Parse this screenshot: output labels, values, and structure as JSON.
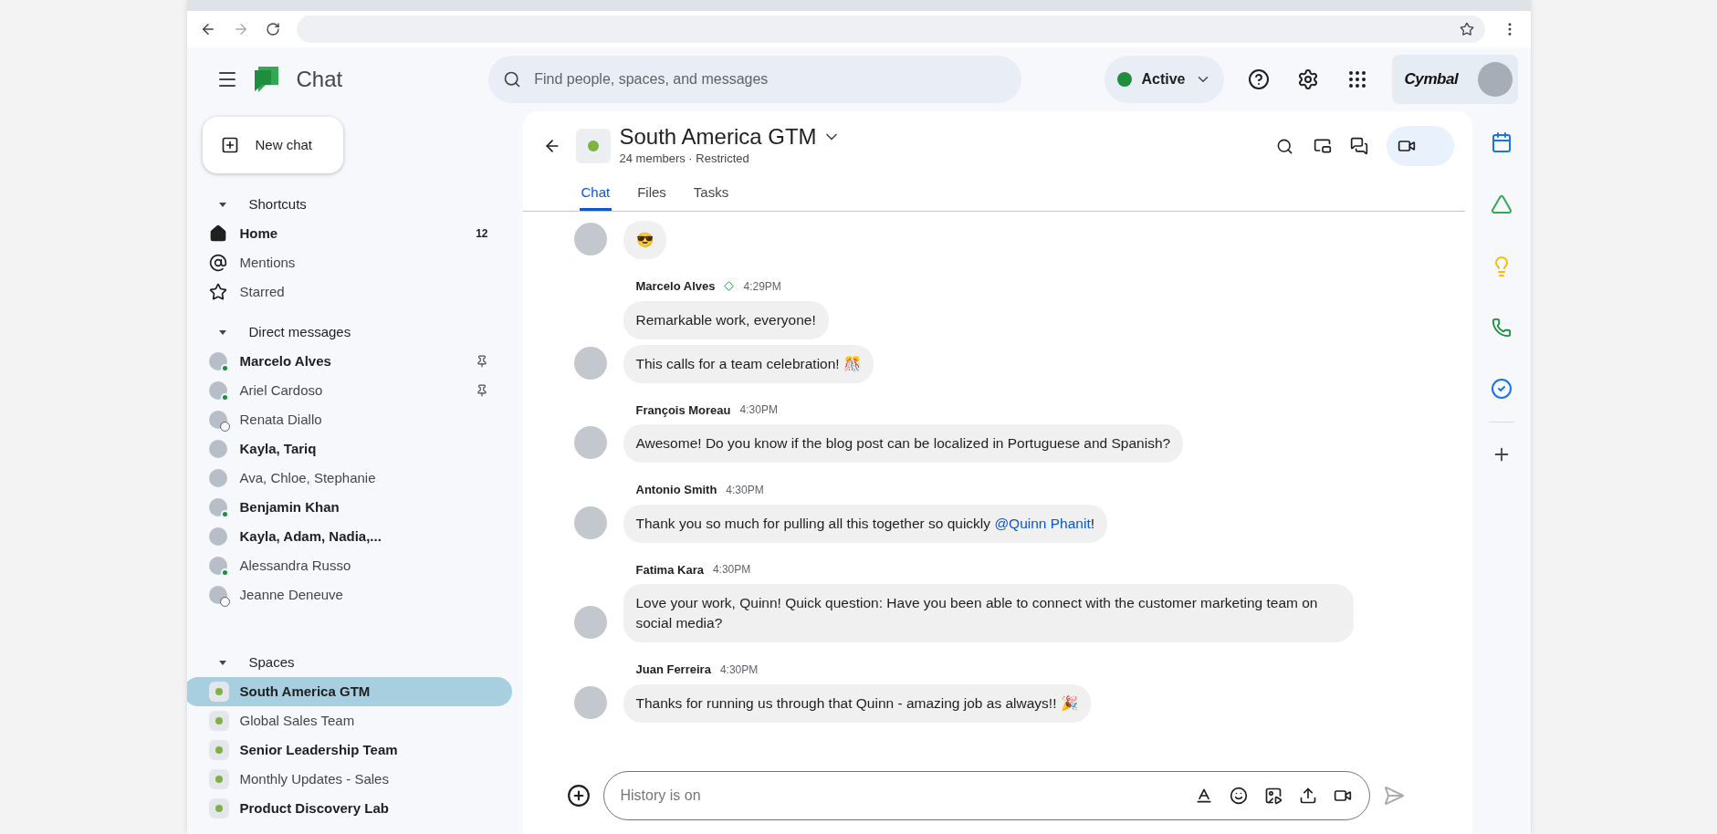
{
  "header": {
    "app_name": "Chat",
    "search": {
      "placeholder": "Find people, spaces, and messages"
    },
    "status": {
      "label": "Active",
      "active": true
    },
    "brand": "Cymbal"
  },
  "new_chat": "New chat",
  "sidebar": {
    "sections": [
      {
        "title": "Shortcuts",
        "kind": "shortcuts",
        "expanded": true,
        "items": [
          {
            "label": "Home",
            "unread": true,
            "count": "12"
          },
          {
            "label": "Mentions",
            "unread": false
          },
          {
            "label": "Starred",
            "unread": false
          }
        ]
      },
      {
        "title": "Direct messages",
        "kind": "people",
        "expanded": true,
        "items": [
          {
            "label": "Marcelo Alves",
            "unread": true,
            "pinned": true,
            "online": true
          },
          {
            "label": "Ariel Cardoso",
            "unread": false,
            "pinned": true,
            "online": true
          },
          {
            "label": "Renata Diallo",
            "unread": false,
            "pinned": false,
            "online": false
          },
          {
            "label": "Kayla, Tariq",
            "unread": true,
            "pinned": false
          },
          {
            "label": "Ava, Chloe, Stephanie",
            "unread": false,
            "pinned": false
          },
          {
            "label": "Benjamin Khan",
            "unread": true,
            "pinned": false,
            "online": true
          },
          {
            "label": "Kayla, Adam, Nadia,...",
            "unread": true,
            "pinned": false
          },
          {
            "label": "Alessandra Russo",
            "unread": false,
            "pinned": false,
            "online": true
          },
          {
            "label": "Jeanne Deneuve",
            "unread": false,
            "pinned": false,
            "online": false
          }
        ]
      },
      {
        "title": "Spaces",
        "kind": "spaces",
        "expanded": true,
        "items": [
          {
            "label": "South America GTM",
            "unread": true,
            "selected": true
          },
          {
            "label": "Global Sales Team",
            "unread": false,
            "selected": false
          },
          {
            "label": "Senior Leadership Team",
            "unread": true,
            "selected": false
          },
          {
            "label": "Monthly Updates - Sales",
            "unread": false,
            "selected": false
          },
          {
            "label": "Product Discovery Lab",
            "unread": true,
            "selected": false
          }
        ]
      }
    ]
  },
  "chat": {
    "title": "South America GTM",
    "subtitle": "24 members · Restricted",
    "tabs": [
      {
        "label": "Chat",
        "selected": true
      },
      {
        "label": "Files",
        "selected": false
      },
      {
        "label": "Tasks",
        "selected": false
      }
    ],
    "messages": [
      {
        "bubbles": [
          [
            {
              "text": "😎"
            }
          ]
        ]
      },
      {
        "author": "Marcelo Alves",
        "time": "4:29PM",
        "badge": true,
        "bubbles": [
          [
            {
              "text": "Remarkable work, everyone!"
            }
          ],
          [
            {
              "text": "This calls for a team celebration!  🎊"
            }
          ]
        ]
      },
      {
        "author": "François Moreau",
        "time": "4:30PM",
        "badge": false,
        "bubbles": [
          [
            {
              "text": "Awesome! Do you know if the blog post can be localized in Portuguese and Spanish?"
            }
          ]
        ]
      },
      {
        "author": "Antonio Smith",
        "time": "4:30PM",
        "badge": false,
        "bubbles": [
          [
            {
              "text": "Thank you so much for pulling all this together so quickly "
            },
            {
              "mention": "@Quinn Phanit"
            },
            {
              "text": "!"
            }
          ]
        ]
      },
      {
        "author": "Fatima Kara",
        "time": "4:30PM",
        "badge": false,
        "bubbles": [
          [
            {
              "text": "Love your work, Quinn! Quick question: Have you been able to connect with the customer marketing team on social media?"
            }
          ]
        ]
      },
      {
        "author": "Juan Ferreira",
        "time": "4:30PM",
        "badge": false,
        "bubbles": [
          [
            {
              "text": "Thanks for running us through that Quinn - amazing job as always!! 🎉"
            }
          ]
        ]
      }
    ],
    "compose": {
      "placeholder": "History is on"
    }
  }
}
